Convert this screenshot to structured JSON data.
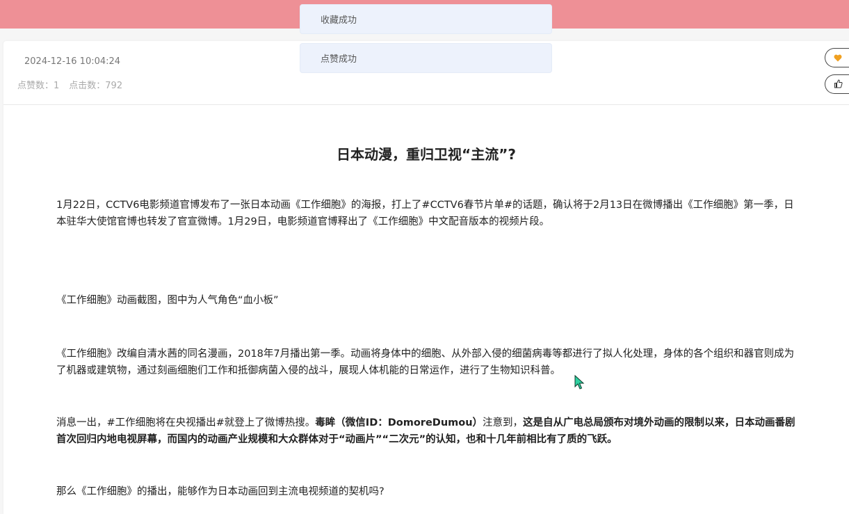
{
  "meta": {
    "date": "2024-12-16 10:04:24",
    "likes_label": "点赞数：1",
    "clicks_label": "点击数：792"
  },
  "toasts": [
    "收藏成功",
    "点赞成功"
  ],
  "article": {
    "title": "日本动漫，重归卫视“主流”?",
    "p1": "1月22日，CCTV6电影频道官博发布了一张日本动画《工作细胞》的海报，打上了#CCTV6春节片单#的话题，确认将于2月13日在微博播出《工作细胞》第一季，日本驻华大使馆官博也转发了官宣微博。1月29日，电影频道官博释出了《工作细胞》中文配音版本的视频片段。",
    "caption": "《工作细胞》动画截图，图中为人气角色“血小板”",
    "p2": "《工作细胞》改编自清水茜的同名漫画，2018年7月播出第一季。动画将身体中的细胞、从外部入侵的细菌病毒等都进行了拟人化处理，身体的各个组织和器官则成为了机器或建筑物，通过刻画细胞们工作和抵御病菌入侵的战斗，展现人体机能的日常运作，进行了生物知识科普。",
    "p3_a": "消息一出，#工作细胞将在央视播出#就登上了微博热搜。",
    "p3_b": "毒眸（微信ID：DomoreDumou）",
    "p3_c": "注意到，",
    "p3_d": "这是自从广电总局颁布对境外动画的限制以来，日本动画番剧首次回归内地电视屏幕，而国内的动画产业规模和大众群体对于“动画片”“二次元”的认知，也和十几年前相比有了质的飞跃。",
    "p4": "那么《工作细胞》的播出，能够作为日本动画回到主流电视频道的契机吗?"
  },
  "icons": {
    "favorite": "heart-icon",
    "like": "thumbs-up-icon"
  },
  "colors": {
    "topbar": "#ee9096",
    "toast_bg": "#edf2fc",
    "heart": "#f0a020"
  }
}
